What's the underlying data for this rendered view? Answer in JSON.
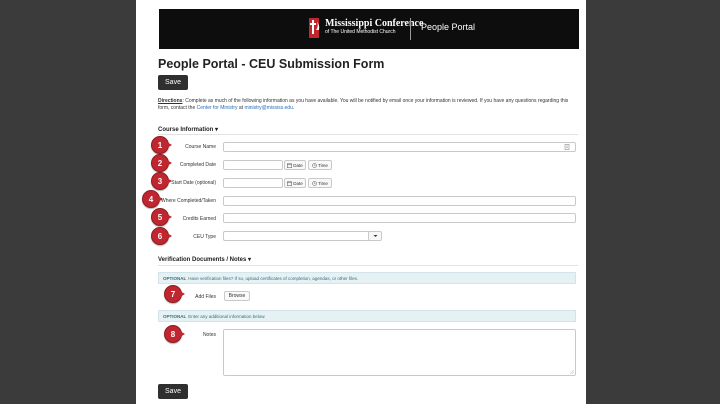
{
  "header": {
    "brand": "Mississippi Conference",
    "brand_sub": "of The United Methodist Church",
    "portal": "People Portal"
  },
  "page_title": "People Portal - CEU Submission Form",
  "save_label": "Save",
  "directions": {
    "label": "Directions",
    "text": ": Complete as much of the following information as you have available. You will be notified by email once your information is reviewed. If you have any questions regarding this form, contact the ",
    "link1": "Center for Ministry",
    "mid": " at ",
    "link2": "ministry@mississ.edu",
    "end": "."
  },
  "course_section": "Course Information ▾",
  "fields": {
    "course_name": "Course Name",
    "completed_date": "Completed Date",
    "start_date": "Start Date (optional)",
    "where_completed": "Where Completed/Taken",
    "credits_earned": "Credits Earned",
    "ceu_type": "CEU Type"
  },
  "date_addon": "Date",
  "time_addon": "Time",
  "verification_section": "Verification Documents / Notes ▾",
  "optional_label": "OPTIONAL",
  "files_info": "Have verification files? If so, upload certificates of completion, agendas, or other files.",
  "add_files_label": "Add Files",
  "browse_label": "Browse",
  "notes_info": "Enter any additional information below.",
  "notes_label": "Notes",
  "markers": [
    "1",
    "2",
    "3",
    "4",
    "5",
    "6",
    "7",
    "8"
  ],
  "colors": {
    "marker": "#c0262f",
    "banner": "#0d0d0d",
    "button": "#2f2f2f",
    "info_bg": "#e6f1f4"
  },
  "icons": {
    "calendar": "calendar-icon",
    "clock": "clock-icon",
    "caret": "caret-down-icon",
    "logo": "cross-flame-icon"
  }
}
